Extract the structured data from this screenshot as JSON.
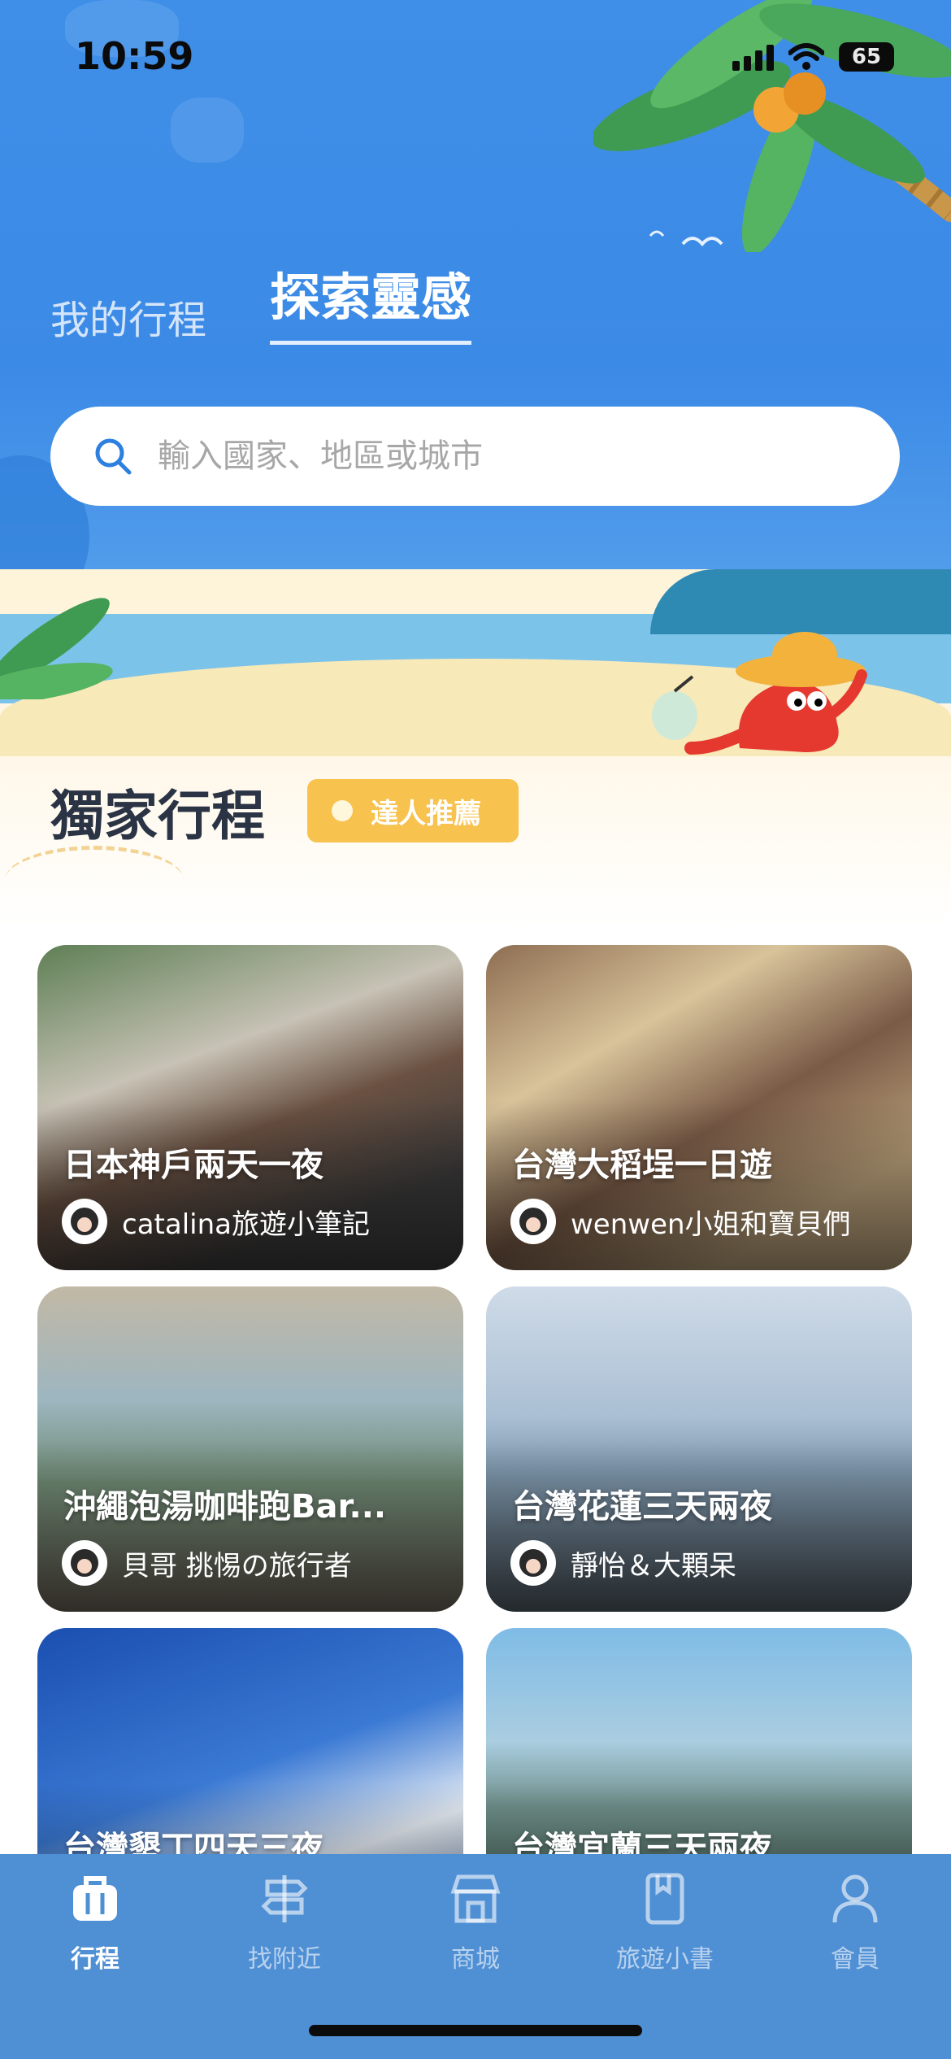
{
  "status_bar": {
    "time": "10:59",
    "battery": "65"
  },
  "tabs": {
    "my_trips": "我的行程",
    "explore": "探索靈感"
  },
  "search": {
    "placeholder": "輸入國家、地區或城市"
  },
  "section": {
    "title": "獨家行程",
    "badge": "達人推薦"
  },
  "cards": [
    {
      "title": "日本神戶兩天一夜",
      "author": "catalina旅遊小筆記"
    },
    {
      "title": "台灣大稻埕一日遊",
      "author": "wenwen小姐和寶貝們"
    },
    {
      "title": "沖繩泡湯咖啡跑Bar...",
      "author": "貝哥 挑惕の旅行者"
    },
    {
      "title": "台灣花蓮三天兩夜",
      "author": "靜怡＆大顆呆"
    },
    {
      "title": "台灣墾丁四天三夜",
      "author": ""
    },
    {
      "title": "台灣宜蘭三天兩夜",
      "author": ""
    }
  ],
  "tabbar": {
    "items": [
      {
        "label": "行程",
        "icon": "luggage-icon"
      },
      {
        "label": "找附近",
        "icon": "signpost-icon"
      },
      {
        "label": "商城",
        "icon": "shop-icon"
      },
      {
        "label": "旅遊小書",
        "icon": "book-icon"
      },
      {
        "label": "會員",
        "icon": "person-icon"
      }
    ]
  },
  "colors": {
    "sky": "#3f8fe8",
    "tabbar": "#4f8fd4",
    "badge": "#f7c24d",
    "title": "#2b3445"
  }
}
